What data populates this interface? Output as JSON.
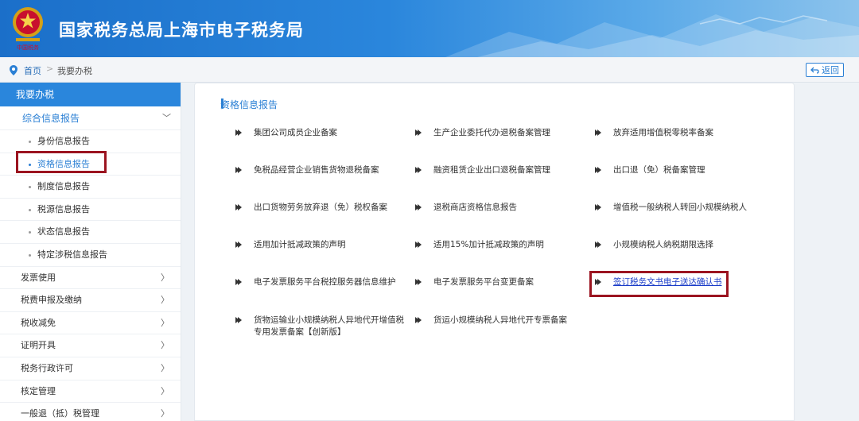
{
  "header": {
    "title": "国家税务总局上海市电子税务局"
  },
  "breadcrumb": {
    "home": "首页",
    "separator": ">",
    "current": "我要办税"
  },
  "back_button": {
    "label": "返回"
  },
  "sidebar": {
    "heading": "我要办税",
    "group": "综合信息报告",
    "group_chevron": "﹀",
    "sub_items": [
      "身份信息报告",
      "资格信息报告",
      "制度信息报告",
      "税源信息报告",
      "状态信息报告",
      "特定涉税信息报告"
    ],
    "active_sub": "资格信息报告",
    "categories": [
      "发票使用",
      "税费申报及缴纳",
      "税收减免",
      "证明开具",
      "税务行政许可",
      "核定管理",
      "一般退（抵）税管理"
    ],
    "category_arrow": "〉"
  },
  "panel": {
    "title": "资格信息报告",
    "items": [
      "集团公司成员企业备案",
      "生产企业委托代办退税备案管理",
      "放弃适用增值税零税率备案",
      "免税品经营企业销售货物退税备案",
      "融资租赁企业出口退税备案管理",
      "出口退（免）税备案管理",
      "出口货物劳务放弃退（免）税权备案",
      "退税商店资格信息报告",
      "增值税一般纳税人转回小规模纳税人",
      "适用加计抵减政策的声明",
      "适用15%加计抵减政策的声明",
      "小规模纳税人纳税期限选择",
      "电子发票服务平台税控服务器信息维护",
      "电子发票服务平台变更备案",
      "签订税务文书电子送达确认书",
      "货物运输业小规模纳税人异地代开增值税专用发票备案【创新版】",
      "货运小规模纳税人异地代开专票备案"
    ]
  },
  "colors": {
    "primary": "#2a86dc",
    "link": "#1a3cc8",
    "highlight": "#9b1420"
  }
}
